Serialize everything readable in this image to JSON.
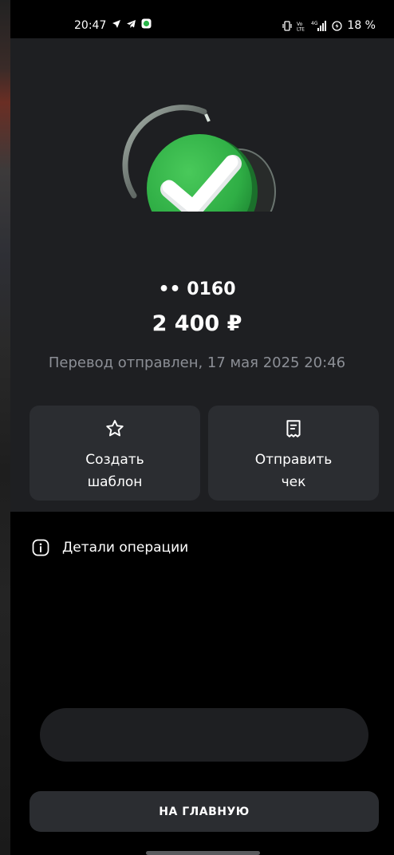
{
  "status_bar": {
    "time": "20:47",
    "battery": "18 %",
    "icons": [
      "navigation-icon",
      "telegram-icon",
      "messenger-icon",
      "vibrate-icon",
      "volte-icon",
      "signal-icon",
      "battery-icon"
    ],
    "network": "4G"
  },
  "transfer": {
    "card_masked": "•• 0160",
    "amount": "2 400 ₽",
    "status_text": "Перевод отправлен, 17 мая 2025 20:46"
  },
  "actions": [
    {
      "label": "Создать\nшаблон",
      "icon": "star-icon"
    },
    {
      "label": "Отправить\nчек",
      "icon": "receipt-icon"
    }
  ],
  "details": {
    "label": "Детали операции",
    "icon": "info-icon"
  },
  "main_button": {
    "label": "НА ГЛАВНУЮ"
  },
  "colors": {
    "background": "#000000",
    "panel": "#1e1f22",
    "button": "#2b2d31",
    "success_green": "#34b24a",
    "muted_text": "#8c8f96"
  }
}
